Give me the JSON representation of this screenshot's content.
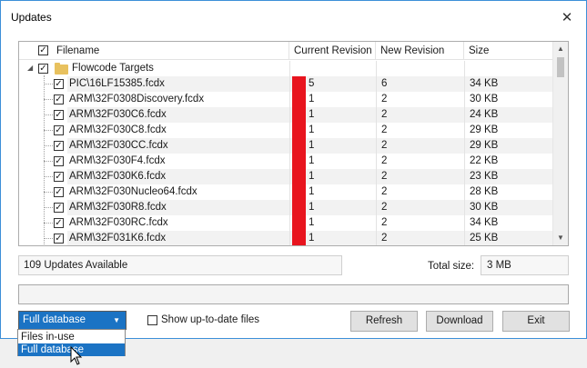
{
  "window": {
    "title": "Updates",
    "close_glyph": "✕"
  },
  "grid": {
    "columns": [
      "Filename",
      "Current Revision",
      "New Revision",
      "Size"
    ],
    "folder": "Flowcode Targets",
    "rows": [
      {
        "file": "PIC\\16LF15385.fcdx",
        "cur": "5",
        "new": "6",
        "size": "34 KB"
      },
      {
        "file": "ARM\\32F0308Discovery.fcdx",
        "cur": "1",
        "new": "2",
        "size": "30 KB"
      },
      {
        "file": "ARM\\32F030C6.fcdx",
        "cur": "1",
        "new": "2",
        "size": "24 KB"
      },
      {
        "file": "ARM\\32F030C8.fcdx",
        "cur": "1",
        "new": "2",
        "size": "29 KB"
      },
      {
        "file": "ARM\\32F030CC.fcdx",
        "cur": "1",
        "new": "2",
        "size": "29 KB"
      },
      {
        "file": "ARM\\32F030F4.fcdx",
        "cur": "1",
        "new": "2",
        "size": "22 KB"
      },
      {
        "file": "ARM\\32F030K6.fcdx",
        "cur": "1",
        "new": "2",
        "size": "23 KB"
      },
      {
        "file": "ARM\\32F030Nucleo64.fcdx",
        "cur": "1",
        "new": "2",
        "size": "28 KB"
      },
      {
        "file": "ARM\\32F030R8.fcdx",
        "cur": "1",
        "new": "2",
        "size": "30 KB"
      },
      {
        "file": "ARM\\32F030RC.fcdx",
        "cur": "1",
        "new": "2",
        "size": "34 KB"
      },
      {
        "file": "ARM\\32F031K6.fcdx",
        "cur": "1",
        "new": "2",
        "size": "25 KB"
      }
    ]
  },
  "status": {
    "updates_text": "109 Updates Available",
    "total_label": "Total size:",
    "total_value": "3 MB"
  },
  "controls": {
    "database_selected": "Full database",
    "database_options": [
      "Files in-use",
      "Full database"
    ],
    "show_uptodate_label": "Show up-to-date files",
    "refresh_label": "Refresh",
    "download_label": "Download",
    "exit_label": "Exit"
  },
  "colors": {
    "accent": "#1b73c4",
    "revision_flag": "#e8141e",
    "window_border": "#3c8fd8"
  }
}
